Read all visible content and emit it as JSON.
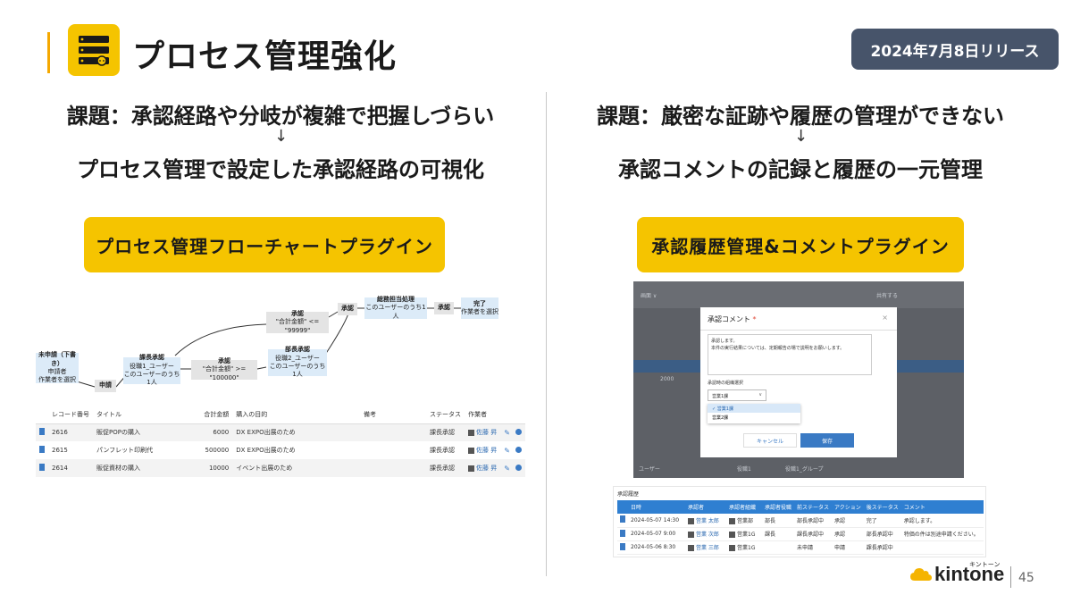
{
  "header": {
    "title": "プロセス管理強化",
    "release": "2024年7月8日リリース"
  },
  "left": {
    "issue": "課題：承認経路や分岐が複雑で把握しづらい",
    "arrow": "↓",
    "solution": "プロセス管理で設定した承認経路の可視化",
    "plugin": "プロセス管理フローチャートプラグイン",
    "flow": {
      "start_title": "未申請（下書き）",
      "start_l1": "申請者",
      "start_l2": "作業者を選択",
      "apply": "申請",
      "kacho_title": "課長承認",
      "kacho_l1": "役職1_ユーザー",
      "kacho_l2": "このユーザーのうち1人",
      "approve": "承認",
      "cond_low": "\"合計金額\" >= \"100000\"",
      "cond_high": "\"合計金額\" <= \"99999\"",
      "bucho_title": "部長承認",
      "bucho_l1": "役職2_ユーザー",
      "bucho_l2": "このユーザーのうち1人",
      "soumu_title": "総務担当処理",
      "soumu_l1": "このユーザーのうち1人",
      "done_title": "完了",
      "done_l1": "作業者を選択"
    },
    "table": {
      "headers": [
        "レコード番号",
        "タイトル",
        "合計金額",
        "購入の目的",
        "備考",
        "ステータス",
        "作業者"
      ],
      "rows": [
        {
          "id": "2616",
          "title": "販促POPの購入",
          "amount": "6000",
          "purpose": "DX EXPO出展のため",
          "status": "課長承認",
          "worker": "佐藤 昇"
        },
        {
          "id": "2615",
          "title": "パンフレット印刷代",
          "amount": "500000",
          "purpose": "DX EXPO出展のため",
          "status": "課長承認",
          "worker": "佐藤 昇"
        },
        {
          "id": "2614",
          "title": "販促資材の購入",
          "amount": "10000",
          "purpose": "イベント出展のため",
          "status": "課長承認",
          "worker": "佐藤 昇"
        }
      ]
    }
  },
  "right": {
    "issue": "課題：厳密な証跡や履歴の管理ができない",
    "arrow": "↓",
    "solution": "承認コメントの記録と履歴の一元管理",
    "plugin": "承認履歴管理&コメントプラグイン",
    "screenshot": {
      "topbar_left": "画面 ∨",
      "topbar_right": "共有する",
      "bg_value": "2000",
      "bg_user": "ユーザー",
      "bg_role": "役職1",
      "bg_group": "役職1_グループ"
    },
    "modal": {
      "title": "承認コメント",
      "required": "*",
      "close": "×",
      "comment_l1": "承認します。",
      "comment_l2": "本件の実行結果については、定期報告の場で説明をお願いします。",
      "select_label": "承認時の組織選択",
      "select_value": "営業1課",
      "options": [
        "✓ 営業1課",
        "営業2課"
      ],
      "cancel": "キャンセル",
      "save": "保存"
    },
    "history": {
      "title": "承認履歴",
      "headers": [
        "日時",
        "承認者",
        "承認者組織",
        "承認者役職",
        "前ステータス",
        "アクション",
        "後ステータス",
        "コメント"
      ],
      "rows": [
        {
          "date": "2024-05-07 14:30",
          "user": "営業 太郎",
          "org": "営業部",
          "role": "部長",
          "before": "部長承認中",
          "action": "承認",
          "after": "完了",
          "comment": "承認します。"
        },
        {
          "date": "2024-05-07 9:00",
          "user": "営業 次郎",
          "org": "営業1G",
          "role": "課長",
          "before": "課長承認中",
          "action": "承認",
          "after": "部長承認中",
          "comment": "特価の件は別途申請ください。"
        },
        {
          "date": "2024-05-06 8:30",
          "user": "営業 三郎",
          "org": "営業1G",
          "role": "",
          "before": "未申請",
          "action": "申請",
          "after": "課長承認中",
          "comment": ""
        }
      ]
    }
  },
  "footer": {
    "brand": "kintone",
    "brand_kana": "キントーン",
    "page": "45"
  },
  "colors": {
    "accent": "#f5c400",
    "badge": "#47546a",
    "flow_blue": "#dcebf8",
    "table_header_blue": "#2f7fd1"
  },
  "icons": {
    "title": "server-list-icon"
  }
}
